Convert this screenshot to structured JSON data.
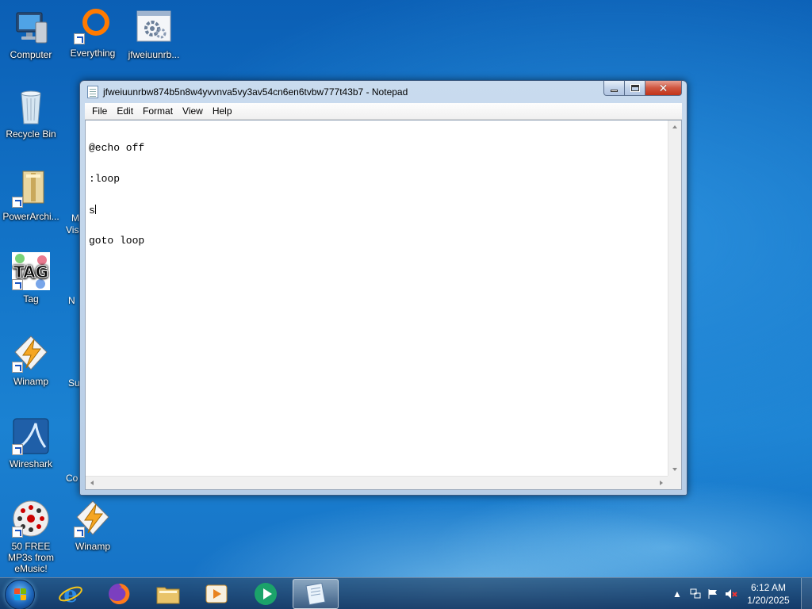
{
  "desktop": {
    "icons": [
      {
        "label": "Computer"
      },
      {
        "label": "Everything"
      },
      {
        "label": "jfweiuunrb..."
      },
      {
        "label": "Recycle Bin"
      },
      {
        "label": "PowerArchi..."
      },
      {
        "label": "Tag"
      },
      {
        "label": "Winamp"
      },
      {
        "label": "Wireshark"
      },
      {
        "label": "50 FREE MP3s from eMusic!"
      },
      {
        "label": "Winamp"
      }
    ],
    "partial_labels": [
      "M",
      "Vis",
      "N",
      "Su",
      "Co"
    ]
  },
  "window": {
    "title": "jfweiuunrbw874b5n8w4yvvnva5vy3av54cn6en6tvbw777t43b7 - Notepad",
    "menu": [
      "File",
      "Edit",
      "Format",
      "View",
      "Help"
    ],
    "lines": [
      "@echo off",
      ":loop",
      "s",
      "goto loop"
    ]
  },
  "tray": {
    "time": "6:12 AM",
    "date": "1/20/2025"
  },
  "colors": {
    "accent": "#1b82d2",
    "close_button": "#c2331a"
  }
}
